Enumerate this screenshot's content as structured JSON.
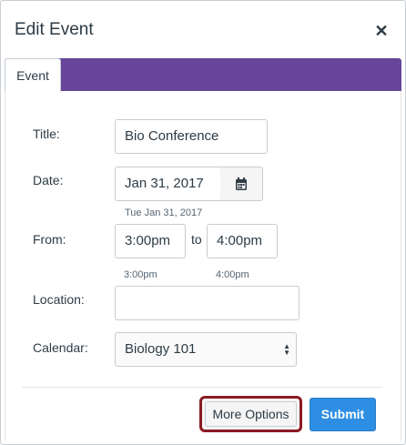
{
  "dialog": {
    "title": "Edit Event",
    "close_icon": "close-icon"
  },
  "tabs": [
    {
      "label": "Event",
      "active": true
    }
  ],
  "form": {
    "title": {
      "label": "Title:",
      "value": "Bio Conference"
    },
    "date": {
      "label": "Date:",
      "value": "Jan 31, 2017",
      "hint": "Tue Jan 31, 2017",
      "icon": "calendar-icon"
    },
    "from": {
      "label": "From:",
      "start_value": "3:00pm",
      "separator": "to",
      "end_value": "4:00pm",
      "start_hint": "3:00pm",
      "end_hint": "4:00pm"
    },
    "location": {
      "label": "Location:",
      "value": ""
    },
    "calendar": {
      "label": "Calendar:",
      "value": "Biology 101"
    }
  },
  "footer": {
    "more_options_label": "More Options",
    "submit_label": "Submit"
  },
  "colors": {
    "tab_bar": "#66459a",
    "submit": "#2d8ee3",
    "highlight": "#8b1a23"
  }
}
